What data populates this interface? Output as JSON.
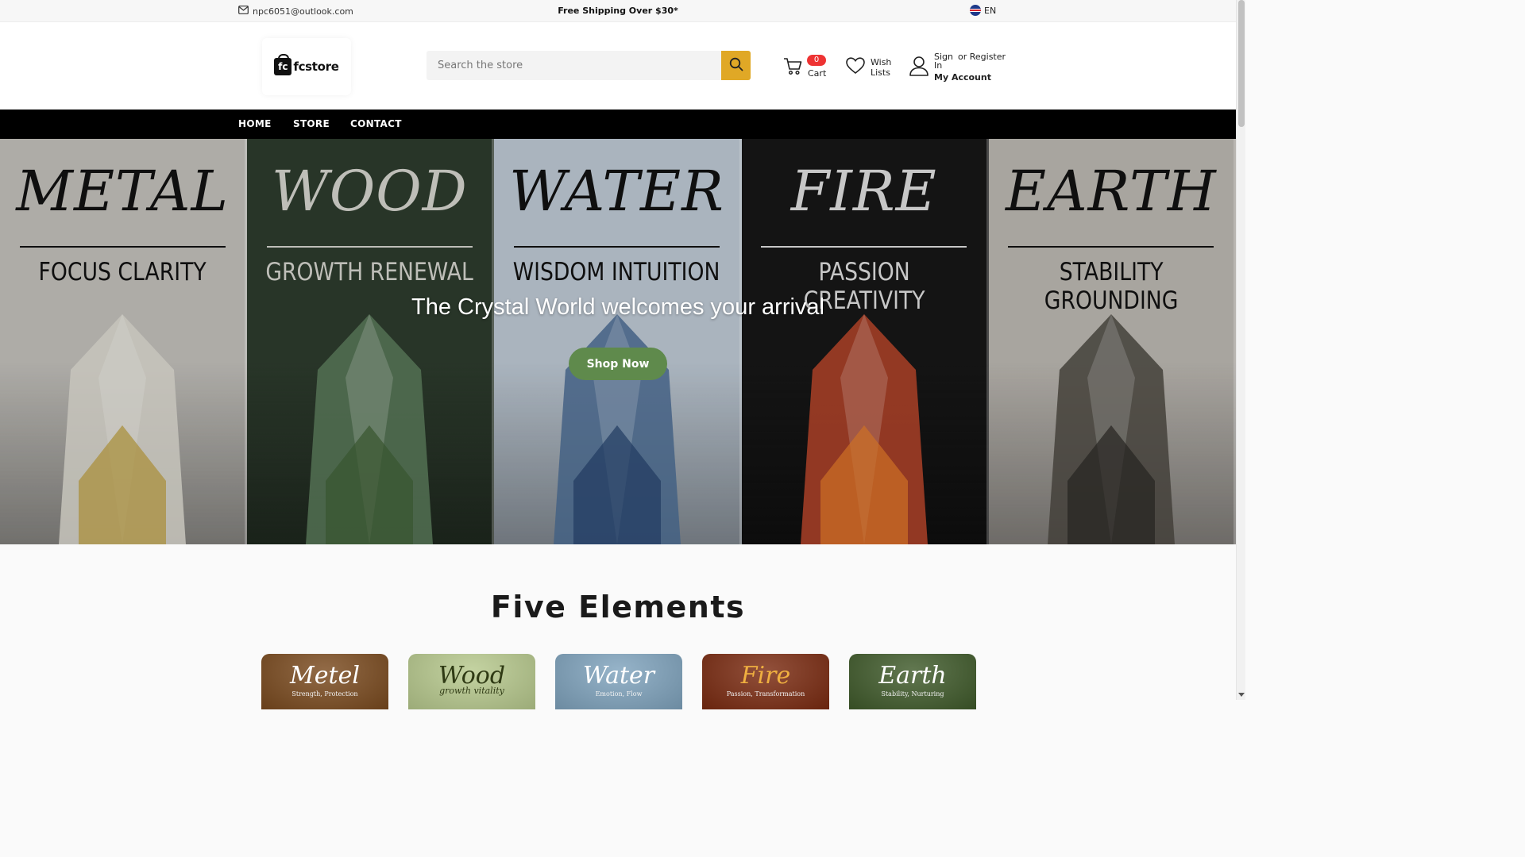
{
  "topbar": {
    "email": "npc6051@outlook.com",
    "promo": "Free Shipping Over $30*",
    "language": "EN"
  },
  "header": {
    "logo_mark": "fc",
    "logo_text": "fcstore",
    "search_placeholder": "Search the store",
    "cart_count": "0",
    "cart_label": "Cart",
    "wish_label": "Wish Lists",
    "sign_in": "Sign In",
    "or_register": "or Register",
    "my_account": "My Account"
  },
  "nav": {
    "items": [
      {
        "label": "HOME"
      },
      {
        "label": "STORE"
      },
      {
        "label": "CONTACT"
      }
    ]
  },
  "hero": {
    "heading": "The Crystal World welcomes your arrival",
    "button": "Shop Now",
    "panels": [
      {
        "title": "METAL",
        "subtitle": "FOCUS CLARITY",
        "bg": "#bdbbb6",
        "text_color": "#111111",
        "crystal": "#d8d6cc",
        "accent": "#b89a3a"
      },
      {
        "title": "WOOD",
        "subtitle": "GROWTH RENEWAL",
        "bg": "#2c3a2c",
        "text_color": "#cfcfc8",
        "crystal": "#5a7a5a",
        "accent": "#3d5d33"
      },
      {
        "title": "WATER",
        "subtitle": "WISDOM INTUITION",
        "bg": "#b9c4cf",
        "text_color": "#111111",
        "crystal": "#4a6a8f",
        "accent": "#23406a"
      },
      {
        "title": "FIRE",
        "subtitle": "PASSION CREATIVITY",
        "bg": "#161616",
        "text_color": "#d8d8d8",
        "crystal": "#b8452a",
        "accent": "#e07a2a"
      },
      {
        "title": "EARTH",
        "subtitle": "STABILITY GROUNDING",
        "bg": "#b7b3ad",
        "text_color": "#111111",
        "crystal": "#4a4640",
        "accent": "#2a2724"
      }
    ]
  },
  "section": {
    "title": "Five Elements",
    "cards": [
      {
        "title": "Metel",
        "subtitle": "Strength, Protection",
        "bg": "#7a4a1e"
      },
      {
        "title": "Wood",
        "subtitle": "growth  vitality",
        "bg": "#b7c98d"
      },
      {
        "title": "Water",
        "subtitle": "Emotion, Flow",
        "bg": "#7fa3bd"
      },
      {
        "title": "Fire",
        "subtitle": "Passion, Transformation",
        "bg": "#7a2a10"
      },
      {
        "title": "Earth",
        "subtitle": "Stability, Nurturing",
        "bg": "#3f5a2a"
      }
    ]
  }
}
